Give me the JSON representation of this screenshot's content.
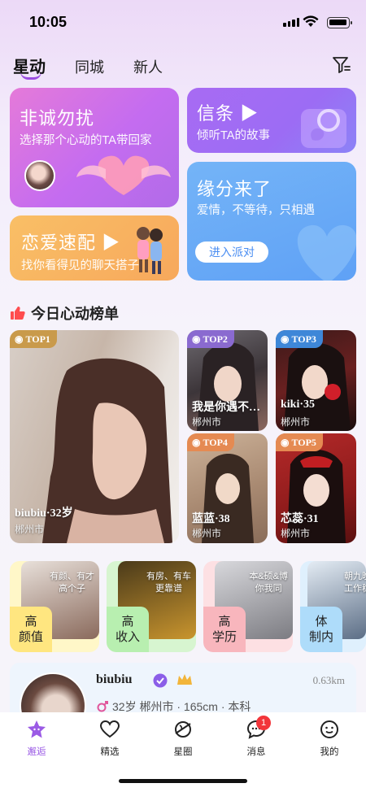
{
  "status_bar": {
    "time": "10:05"
  },
  "top_tabs": [
    {
      "label": "星动",
      "active": true
    },
    {
      "label": "同城",
      "active": false
    },
    {
      "label": "新人",
      "active": false
    }
  ],
  "cards": {
    "no_disturb": {
      "title": "非诚勿扰",
      "subtitle": "选择那个心动的TA带回家"
    },
    "letters": {
      "title": "信条 ▶",
      "subtitle": "倾听TA的故事"
    },
    "fate": {
      "title": "缘分来了",
      "subtitle": "爱情，不等待，只相遇",
      "button": "进入派对"
    },
    "speed_match": {
      "title": "恋爱速配 ▶",
      "subtitle": "找你看得见的聊天搭子"
    }
  },
  "ranking": {
    "title": "今日心动榜单",
    "items": [
      {
        "rank": "TOP1",
        "name": "biubiu·32岁",
        "city": "郴州市",
        "color": "#c99a4b"
      },
      {
        "rank": "TOP2",
        "name": "我是你遇不…",
        "city": "郴州市",
        "color": "#8a6ad0"
      },
      {
        "rank": "TOP3",
        "name": "kiki·35",
        "city": "郴州市",
        "color": "#3e87d8"
      },
      {
        "rank": "TOP4",
        "name": "蓝蓝·38",
        "city": "郴州市",
        "color": "#e58a52"
      },
      {
        "rank": "TOP5",
        "name": "芯蕊·31",
        "city": "郴州市",
        "color": "#e58a52"
      }
    ]
  },
  "categories": [
    {
      "label": "高\n颜值",
      "caption": "有颜、有才\n高个子",
      "tint": "#ffe680"
    },
    {
      "label": "高\n收入",
      "caption": "有房、有车\n更靠谱",
      "tint": "#b8efb0"
    },
    {
      "label": "高\n学历",
      "caption": "本&硕&博\n你我同",
      "tint": "#f8b6bd"
    },
    {
      "label": "体\n制内",
      "caption": "朝九晚\n工作稳",
      "tint": "#aedcfa"
    }
  ],
  "profile": {
    "name": "biubiu",
    "distance": "0.63km",
    "info": "32岁  郴州市 · 165cm · 本科"
  },
  "bottom_nav": [
    {
      "label": "邂逅",
      "icon": "star-face-icon",
      "active": true
    },
    {
      "label": "精选",
      "icon": "heart-icon",
      "active": false
    },
    {
      "label": "星圈",
      "icon": "planet-icon",
      "active": false
    },
    {
      "label": "消息",
      "icon": "chat-icon",
      "active": false,
      "badge": "1"
    },
    {
      "label": "我的",
      "icon": "smile-icon",
      "active": false
    }
  ]
}
